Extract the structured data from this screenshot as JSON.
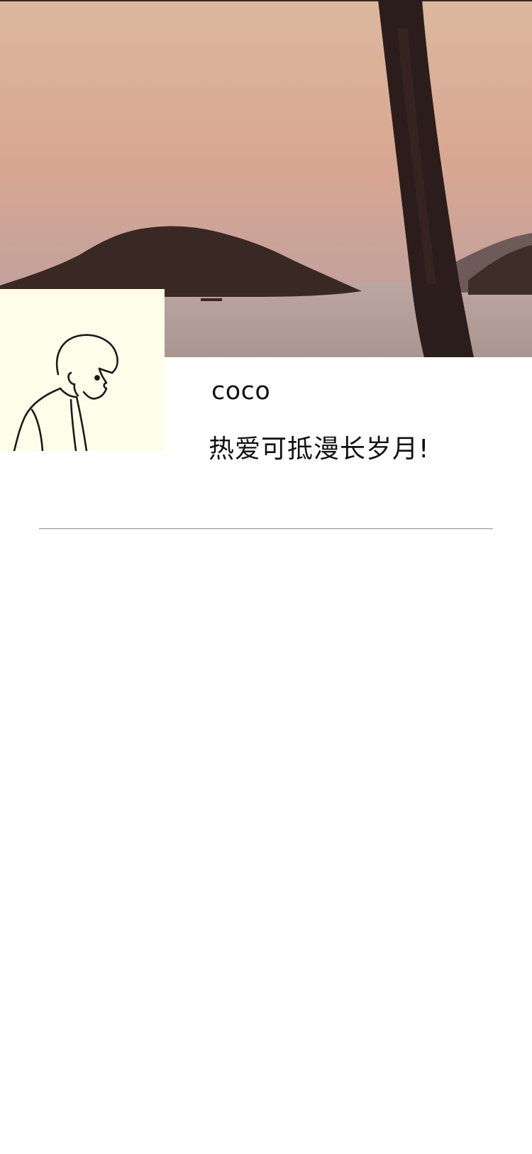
{
  "profile": {
    "username": "coco",
    "bio": "热爱可抵漫长岁月!"
  },
  "cover": {
    "image": "sunset-sea-island-palm-photo",
    "colors": {
      "sky_top": "#dcb79b",
      "sky_mid": "#d9a891",
      "sky_low": "#bfa09f",
      "sea": "#b7a29d",
      "island": "#3d2a26",
      "trunk": "#2b1d1b"
    }
  },
  "avatar": {
    "image": "line-drawing-boy-portrait",
    "background": "#fdfde9"
  },
  "colors": {
    "text": "#111111",
    "divider": "#8a8a8a",
    "page_bg": "#ffffff"
  }
}
